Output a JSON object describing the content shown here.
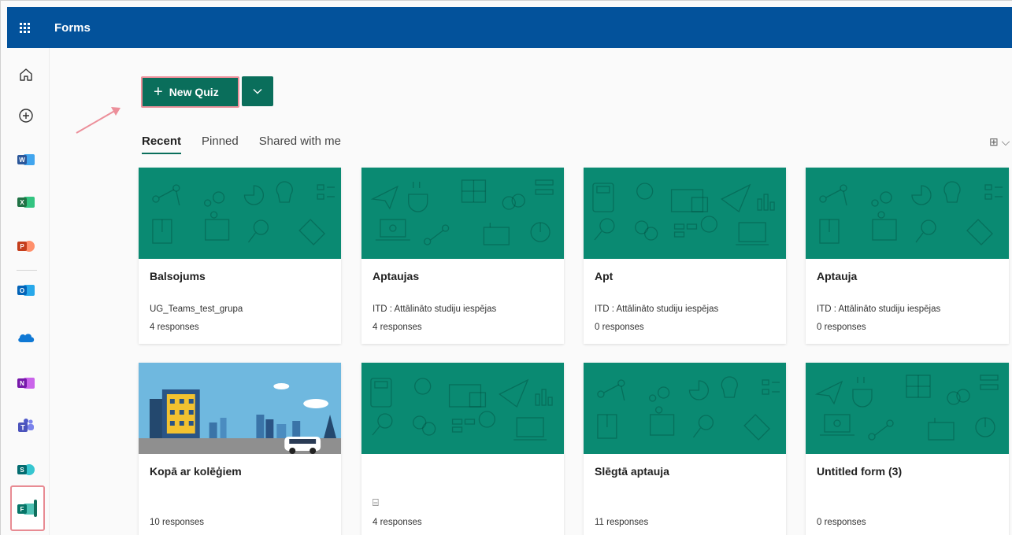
{
  "header": {
    "title": "Forms",
    "waffle_icon": "app-launcher-icon"
  },
  "rail": {
    "items": [
      {
        "name": "home-icon"
      },
      {
        "name": "create-icon"
      },
      {
        "name": "word-icon",
        "letter": "W",
        "color": "#2b579a",
        "back": "#41a5ee"
      },
      {
        "name": "excel-icon",
        "letter": "X",
        "color": "#217346",
        "back": "#33c481"
      },
      {
        "name": "powerpoint-icon",
        "letter": "P",
        "color": "#c43e1c",
        "back": "#ff8f6b"
      },
      {
        "name": "outlook-icon",
        "letter": "O",
        "color": "#0364b8",
        "back": "#28a8ea"
      },
      {
        "name": "onedrive-icon"
      },
      {
        "name": "onenote-icon",
        "letter": "N",
        "color": "#7719aa",
        "back": "#ca64ea"
      },
      {
        "name": "teams-icon"
      },
      {
        "name": "sharepoint-icon",
        "letter": "S",
        "color": "#036c70",
        "back": "#37c6d0"
      },
      {
        "name": "forms-icon",
        "letter": "F",
        "color": "#077568",
        "back": "#4fc2b5"
      }
    ]
  },
  "toolbar": {
    "new_quiz_label": "New Quiz",
    "plus_glyph": "+",
    "dropdown_glyph": "⌵"
  },
  "tabs": [
    {
      "label": "Recent",
      "active": true
    },
    {
      "label": "Pinned",
      "active": false
    },
    {
      "label": "Shared with me",
      "active": false
    }
  ],
  "view_toggle": "⊞ ⌵",
  "cards": [
    {
      "title": "Balsojums",
      "subtitle": "UG_Teams_test_grupa",
      "responses": "4 responses",
      "banner": "pattern-a"
    },
    {
      "title": "Aptaujas",
      "subtitle": "ITD : Attālināto studiju iespējas",
      "responses": "4 responses",
      "banner": "pattern-b"
    },
    {
      "title": "Apt",
      "subtitle": "ITD : Attālināto studiju iespējas",
      "responses": "0 responses",
      "banner": "pattern-c"
    },
    {
      "title": "Aptauja",
      "subtitle": "ITD : Attālināto studiju iespējas",
      "responses": "0 responses",
      "banner": "pattern-a"
    },
    {
      "title": "Kopā ar kolēģiem",
      "subtitle": "",
      "responses": "10 responses",
      "banner": "city-image"
    },
    {
      "title": "",
      "subtitle": "",
      "responses": "4 responses",
      "banner": "pattern-c",
      "quiz_icon": "⌸"
    },
    {
      "title": "Slēgtā aptauja",
      "subtitle": "",
      "responses": "11 responses",
      "banner": "pattern-a"
    },
    {
      "title": "Untitled form (3)",
      "subtitle": "",
      "responses": "0 responses",
      "banner": "pattern-b"
    }
  ],
  "colors": {
    "header": "#03529b",
    "accent": "#0a6e5b",
    "banner": "#0a8a72",
    "highlight": "#ec8f9a"
  }
}
